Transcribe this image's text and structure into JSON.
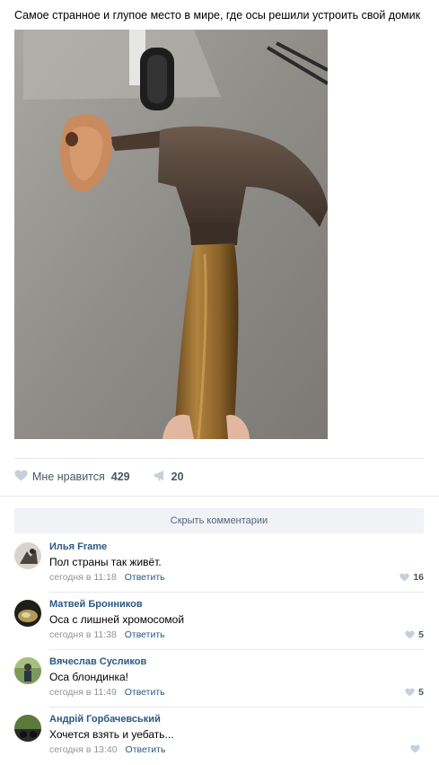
{
  "post": {
    "text": "Самое странное и глупое место в мире, где осы решили устроить свой домик"
  },
  "actions": {
    "like_label": "Мне нравится",
    "like_count": "429",
    "share_count": "20"
  },
  "hide_comments_label": "Скрыть комментарии",
  "comments": [
    {
      "author": "Илья Frame",
      "text": "Пол страны так живёт.",
      "time": "сегодня в 11:18",
      "reply": "Ответить",
      "likes": "16"
    },
    {
      "author": "Матвей Бронников",
      "text": "Оса с лишней хромосомой",
      "time": "сегодня в 11:38",
      "reply": "Ответить",
      "likes": "5"
    },
    {
      "author": "Вячеслав Сусликов",
      "text": "Оса блондинка!",
      "time": "сегодня в 11:49",
      "reply": "Ответить",
      "likes": "5"
    },
    {
      "author": "Андрій Горбачевський",
      "text": "Хочется взять и уебать...",
      "time": "сегодня в 13:40",
      "reply": "Ответить",
      "likes": ""
    }
  ],
  "colors": {
    "link": "#2a5885",
    "muted": "#939393",
    "icon": "#c5d0db",
    "button_bg": "#f0f2f5"
  }
}
